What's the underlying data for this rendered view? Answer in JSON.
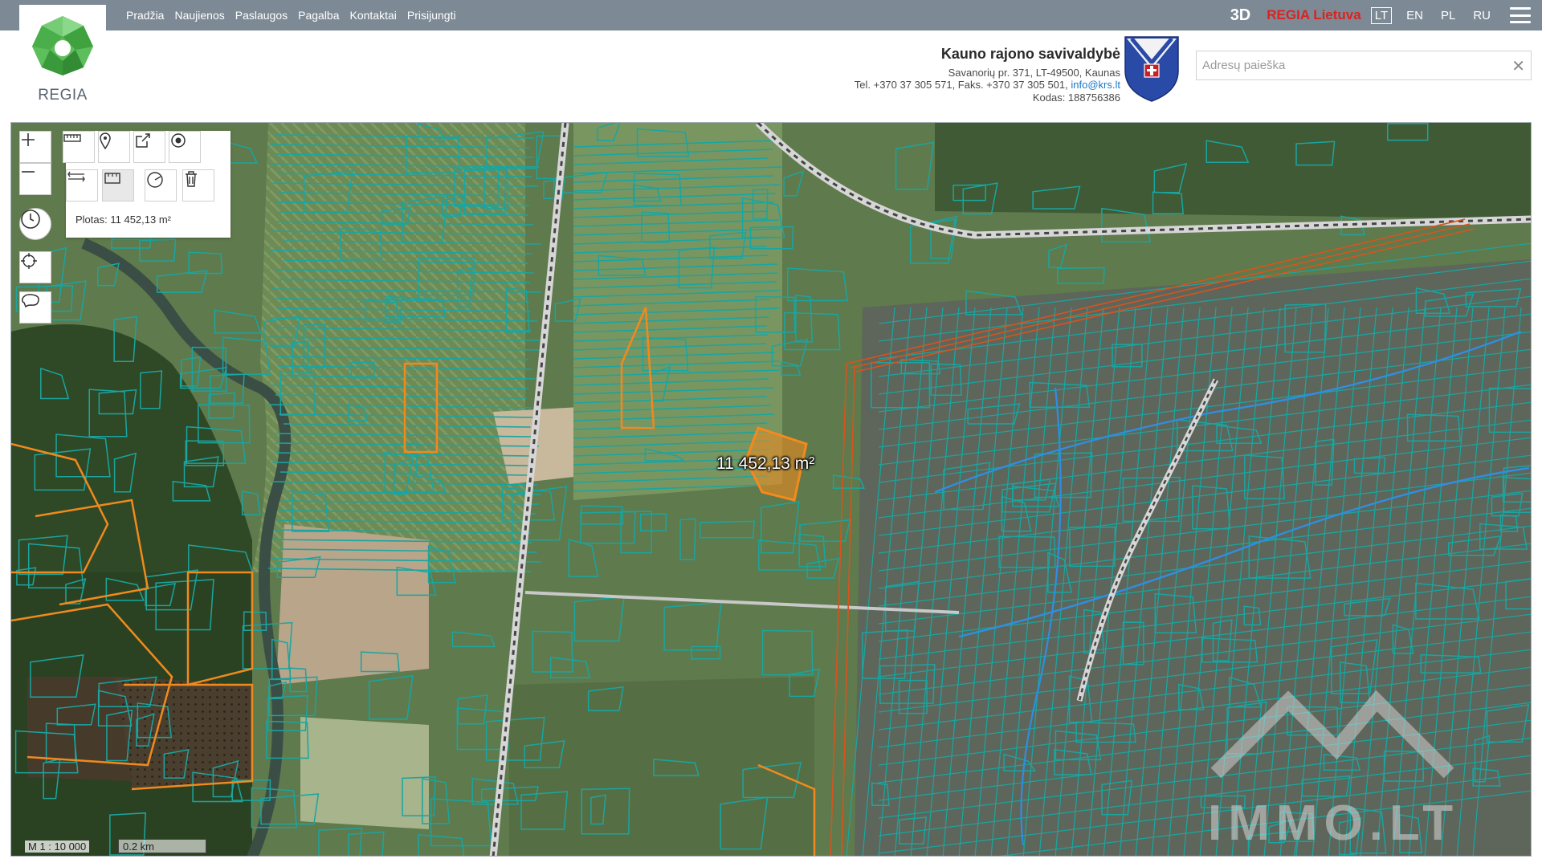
{
  "nav": {
    "items": [
      "Pradžia",
      "Naujienos",
      "Paslaugos",
      "Pagalba",
      "Kontaktai",
      "Prisijungti"
    ],
    "three_d": "3D",
    "regia_lietuva": "REGIA Lietuva",
    "languages": [
      "LT",
      "EN",
      "PL",
      "RU"
    ],
    "active_language": "LT"
  },
  "logo": {
    "text": "REGIA"
  },
  "organization": {
    "name": "Kauno rajono savivaldybė",
    "address": "Savanorių pr. 371, LT-49500, Kaunas",
    "phone": "Tel. +370 37 305 571, Faks. +370 37 305 501,",
    "email": "info@krs.lt",
    "code": "Kodas: 188756386"
  },
  "search": {
    "placeholder": "Adresų paieška",
    "value": ""
  },
  "map": {
    "area_readout": "Plotas: 11 452,13 m²",
    "measure_label": "11 452,13 m²",
    "scale_ratio": "M 1 : 10 000",
    "scale_bar": "0.2 km",
    "watermark": "IMMO.LT"
  },
  "colors": {
    "topbar": "#7d8a96",
    "parcel_lines": "#1aa5a0",
    "forest_lines": "#f08a1e",
    "selected_parcel": "#f58a1c",
    "brand_green": "#5cbf5c",
    "regia_red": "#d8241f"
  }
}
